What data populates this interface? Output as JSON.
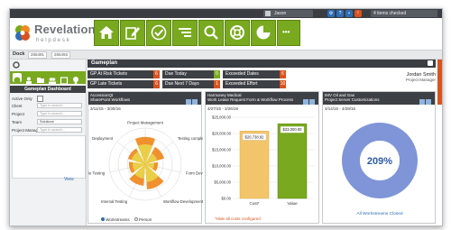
{
  "topbar": {
    "user": "Jason",
    "items_checked": "4 items checked"
  },
  "logo": {
    "name": "Revelation",
    "subtitle": "helpdesk"
  },
  "nav": {
    "icons": [
      "home-icon",
      "edit-icon",
      "check-icon",
      "list-icon",
      "search-icon",
      "lifebuoy-icon",
      "pie-chart-icon",
      "more-icon"
    ],
    "more_label": "•••"
  },
  "breadcrumb": {
    "dock": "Dock",
    "items": [
      "265491",
      "265493"
    ]
  },
  "sidebar": {
    "title": "Gameplan Dashboard",
    "filters": [
      {
        "label": "Active Only",
        "value": ""
      },
      {
        "label": "Client",
        "value": "Type to search..."
      },
      {
        "label": "Project",
        "value": "Type to search..."
      },
      {
        "label": "Team",
        "value": "Solutions"
      },
      {
        "label": "Project Managers",
        "value": "Type to search..."
      }
    ],
    "view_label": "View"
  },
  "gameplan": {
    "title": "Gameplan",
    "kpis": [
      {
        "label": "GP At Risk Tickets",
        "value": "6"
      },
      {
        "label": "Due Today",
        "value": "0"
      },
      {
        "label": "Exceeded Dates",
        "value": "6"
      },
      {
        "label": "GP Late Tickets",
        "value": "6"
      },
      {
        "label": "Due Next 7 Days",
        "value": "1"
      },
      {
        "label": "Exceeded Effort",
        "value": "10"
      }
    ],
    "person": {
      "name": "Jordan Smith",
      "role": "Project Manager"
    }
  },
  "panels": [
    {
      "title": "AccessionQt",
      "subtitle": "SharePoint Workflows",
      "dates": "3/11/15 - 3/30/16",
      "legend": [
        "Workstreams",
        "Person"
      ]
    },
    {
      "title": "Harmoney Medical",
      "subtitle": "Work Lease Request Form & Workflow Process",
      "dates": "4/27/15 - 2/26/16",
      "footnote": "*Hide all costs configured"
    },
    {
      "title": "IMV Oil and Gas",
      "subtitle": "Project Server Customizations",
      "dates": "4/14/15 - 4/29/16",
      "center_value": "209%",
      "caption": "All Workstreams Closed"
    }
  ],
  "chart_data": [
    {
      "type": "radar",
      "categories": [
        "Project Management",
        "Testing comple",
        "Form Dev",
        "Workflow Development",
        "Internal Testing",
        "ie Testing",
        "Deployment"
      ],
      "series": [
        {
          "name": "Workstreams",
          "values": [
            0.75,
            0.55,
            0.35,
            0.7,
            0.6,
            0.45,
            0.5
          ]
        },
        {
          "name": "Person",
          "values": [
            0.55,
            0.35,
            0.25,
            0.5,
            0.4,
            0.35,
            0.4
          ]
        }
      ],
      "colors": [
        "#f08a24",
        "#e8d54a"
      ]
    },
    {
      "type": "bar",
      "categories": [
        "Cost*",
        "Value"
      ],
      "values": [
        20738.82,
        23000.0
      ],
      "value_labels": [
        "$20,738.82",
        "$23,000.00"
      ],
      "yticks": [
        "$0.00",
        "$5,000.00",
        "$10,000.00",
        "$15,000.00",
        "$20,000.00",
        "$25,000.00"
      ],
      "ylim": [
        0,
        25000
      ],
      "colors": [
        "#f3c56b",
        "#79a91f"
      ]
    },
    {
      "type": "pie",
      "values": [
        209
      ],
      "label": "209%",
      "colors": [
        "#7f95d8"
      ]
    }
  ]
}
